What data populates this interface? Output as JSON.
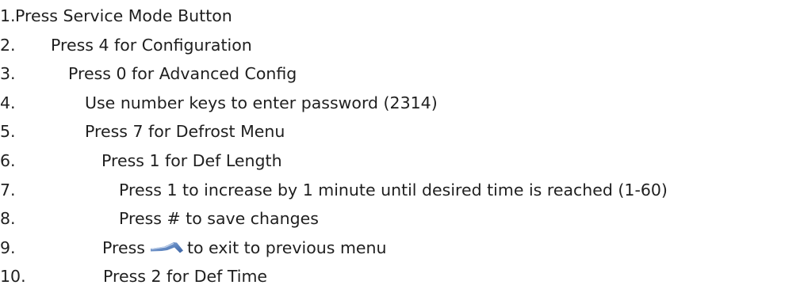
{
  "steps": [
    {
      "number": "1.",
      "text": "Press Service Mode Button"
    },
    {
      "number": "2.",
      "text": "Press 4 for Configuration"
    },
    {
      "number": "3.",
      "text": "Press 0 for Advanced Config"
    },
    {
      "number": "4.",
      "text": "Use number keys to enter password (2314)"
    },
    {
      "number": "5.",
      "text": "Press 7 for Defrost Menu"
    },
    {
      "number": "6.",
      "text": "Press 1 for Def Length"
    },
    {
      "number": "7.",
      "text": "Press 1 to increase by 1 minute until desired time is reached (1-60)"
    },
    {
      "number": "8.",
      "text": "Press # to save changes"
    },
    {
      "number": "9.",
      "text_before": "Press",
      "icon": "back-arrow-key-icon",
      "text_after": "to exit to previous menu"
    },
    {
      "number": "10.",
      "text": "Press 2 for Def Time"
    }
  ],
  "colors": {
    "text": "#1f1f1f",
    "icon": "#6a8fc4"
  }
}
